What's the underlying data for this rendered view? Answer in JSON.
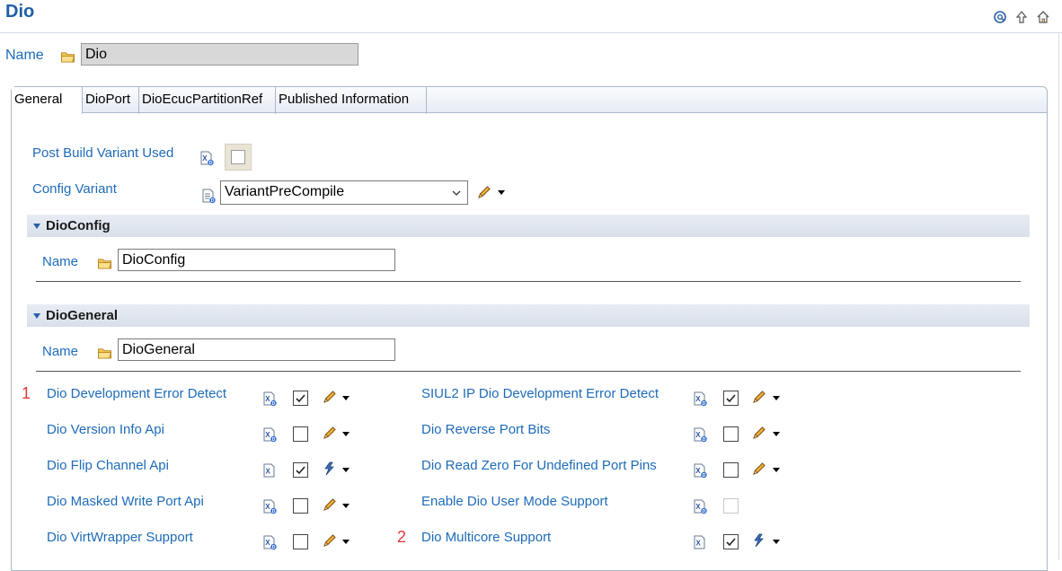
{
  "header": {
    "title": "Dio"
  },
  "top_icons": [
    "at-icon",
    "up-arrow-icon",
    "home-icon"
  ],
  "name_field": {
    "label": "Name",
    "value": "Dio"
  },
  "tabs": [
    {
      "label": "General",
      "active": true
    },
    {
      "label": "DioPort",
      "active": false
    },
    {
      "label": "DioEcucPartitionRef",
      "active": false
    },
    {
      "label": "Published Information",
      "active": false
    }
  ],
  "general": {
    "post_build": {
      "label": "Post Build Variant Used",
      "checked": false
    },
    "config_variant": {
      "label": "Config Variant",
      "value": "VariantPreCompile"
    }
  },
  "dio_config": {
    "title": "DioConfig",
    "name_label": "Name",
    "name_value": "DioConfig"
  },
  "dio_general": {
    "title": "DioGeneral",
    "name_label": "Name",
    "name_value": "DioGeneral",
    "markers": [
      "1",
      "2"
    ],
    "params": {
      "dev_error": {
        "label": "Dio Development Error Detect",
        "checked": true
      },
      "version_info": {
        "label": "Dio Version Info Api",
        "checked": false
      },
      "flip_channel": {
        "label": "Dio Flip Channel Api",
        "checked": true
      },
      "masked_write": {
        "label": "Dio Masked Write Port Api",
        "checked": false
      },
      "virtwrapper": {
        "label": "Dio VirtWrapper Support",
        "checked": false
      },
      "siul2_dev_error": {
        "label": "SIUL2 IP Dio Development Error Detect",
        "checked": true
      },
      "reverse_port": {
        "label": "Dio Reverse Port Bits",
        "checked": false
      },
      "read_zero": {
        "label": "Dio Read Zero For Undefined Port Pins",
        "checked": false
      },
      "user_mode": {
        "label": "Enable Dio User Mode Support",
        "checked": false
      },
      "multicore": {
        "label": "Dio Multicore Support",
        "checked": true
      }
    }
  },
  "colors": {
    "link": "#1e6bb8",
    "title": "#1e5fa8",
    "marker": "#e03c3c",
    "section_bar": "#dde3ec"
  }
}
